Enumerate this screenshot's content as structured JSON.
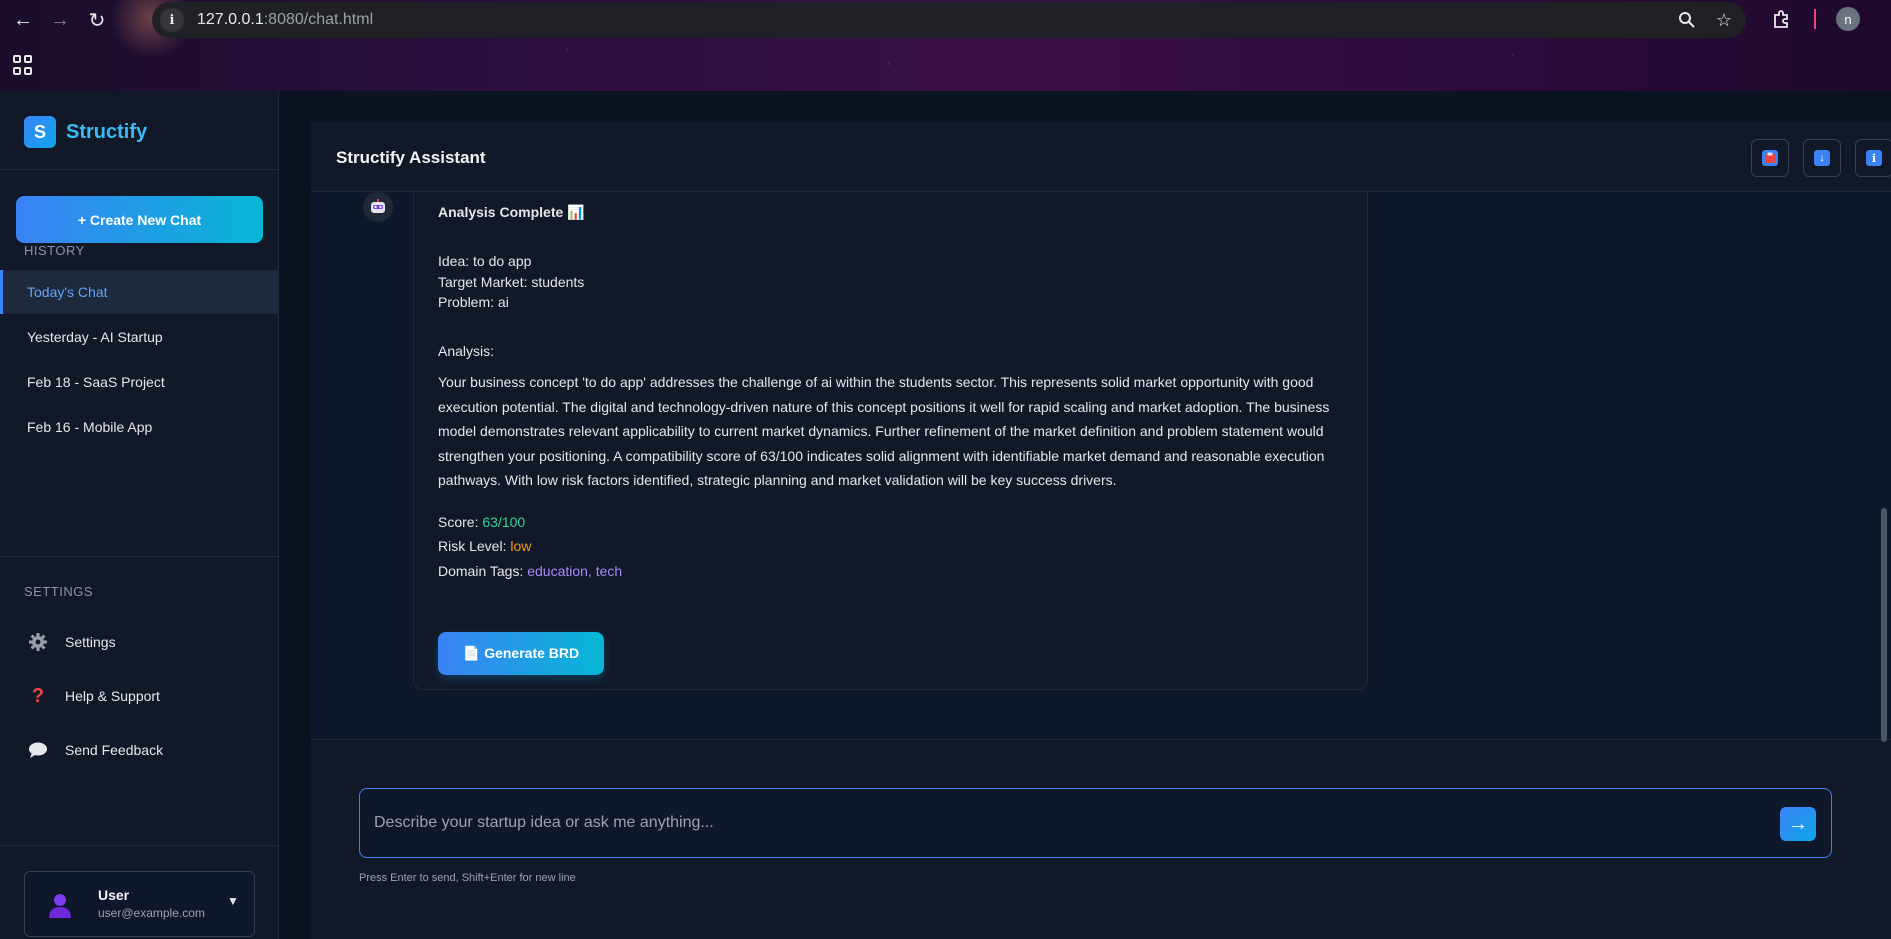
{
  "browser": {
    "url_host": "127.0.0.1",
    "url_rest": ":8080/chat.html",
    "profile_initial": "n",
    "site_info_glyph": "i"
  },
  "sidebar": {
    "brand_letter": "S",
    "brand_name": "Structify",
    "new_chat_label": "+ Create New Chat",
    "history_title": "HISTORY",
    "history": [
      {
        "label": "Today's Chat",
        "active": true
      },
      {
        "label": "Yesterday - AI Startup",
        "active": false
      },
      {
        "label": "Feb 18 - SaaS Project",
        "active": false
      },
      {
        "label": "Feb 16 - Mobile App",
        "active": false
      }
    ],
    "settings_title": "SETTINGS",
    "settings_items": [
      {
        "label": "Settings",
        "icon": "gear-icon"
      },
      {
        "label": "Help & Support",
        "icon": "question-icon"
      },
      {
        "label": "Send Feedback",
        "icon": "speech-bubble-icon"
      }
    ],
    "user": {
      "name": "User",
      "email": "user@example.com"
    }
  },
  "chat": {
    "title": "Structify Assistant",
    "header_actions": [
      "clear-chat",
      "download",
      "info"
    ],
    "message": {
      "heading": "Analysis Complete 📊",
      "idea_label": "Idea:",
      "idea": "to do app",
      "market_label": "Target Market:",
      "market": "students",
      "problem_label": "Problem:",
      "problem": "ai",
      "analysis_label": "Analysis:",
      "analysis": "Your business concept 'to do app' addresses the challenge of ai within the students sector. This represents solid market opportunity with good execution potential. The digital and technology-driven nature of this concept positions it well for rapid scaling and market adoption. The business model demonstrates relevant applicability to current market dynamics. Further refinement of the market definition and problem statement would strengthen your positioning. A compatibility score of 63/100 indicates solid alignment with identifiable market demand and reasonable execution pathways. With low risk factors identified, strategic planning and market validation will be key success drivers.",
      "score_label": "Score:",
      "score": "63/100",
      "risk_label": "Risk Level:",
      "risk": "low",
      "tags_label": "Domain Tags:",
      "tags": "education, tech",
      "brd_button": "📄 Generate BRD"
    },
    "input_placeholder": "Describe your startup idea or ask me anything...",
    "send_glyph": "→",
    "hint": "Press Enter to send, Shift+Enter for new line"
  },
  "colors": {
    "accent": "#3b82f6",
    "accent_cyan": "#06b6d4",
    "score": "#34d399",
    "risk": "#f59e0b",
    "tags": "#a78bfa"
  }
}
